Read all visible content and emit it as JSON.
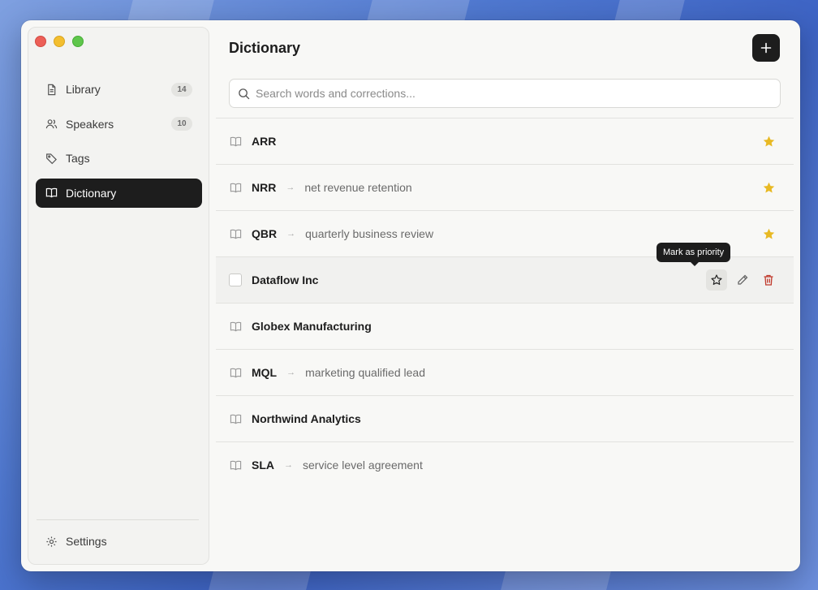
{
  "sidebar": {
    "items": [
      {
        "label": "Library",
        "icon": "document-icon",
        "badge": "14"
      },
      {
        "label": "Speakers",
        "icon": "users-icon",
        "badge": "10"
      },
      {
        "label": "Tags",
        "icon": "tag-icon"
      },
      {
        "label": "Dictionary",
        "icon": "book-icon",
        "active": true
      }
    ],
    "settings_label": "Settings"
  },
  "main": {
    "title": "Dictionary",
    "search_placeholder": "Search words and corrections...",
    "tooltip": "Mark as priority",
    "entries": [
      {
        "term": "ARR",
        "correction": "",
        "priority": true
      },
      {
        "term": "NRR",
        "correction": "net revenue retention",
        "priority": true
      },
      {
        "term": "QBR",
        "correction": "quarterly business review",
        "priority": true
      },
      {
        "term": "Dataflow Inc",
        "correction": "",
        "priority": false,
        "hovered": true
      },
      {
        "term": "Globex Manufacturing",
        "correction": "",
        "priority": false
      },
      {
        "term": "MQL",
        "correction": "marketing qualified lead",
        "priority": false
      },
      {
        "term": "Northwind Analytics",
        "correction": "",
        "priority": false
      },
      {
        "term": "SLA",
        "correction": "service level agreement",
        "priority": false
      }
    ]
  },
  "colors": {
    "star": "#e8b923",
    "delete": "#c0392b",
    "active_bg": "#1d1d1d"
  }
}
